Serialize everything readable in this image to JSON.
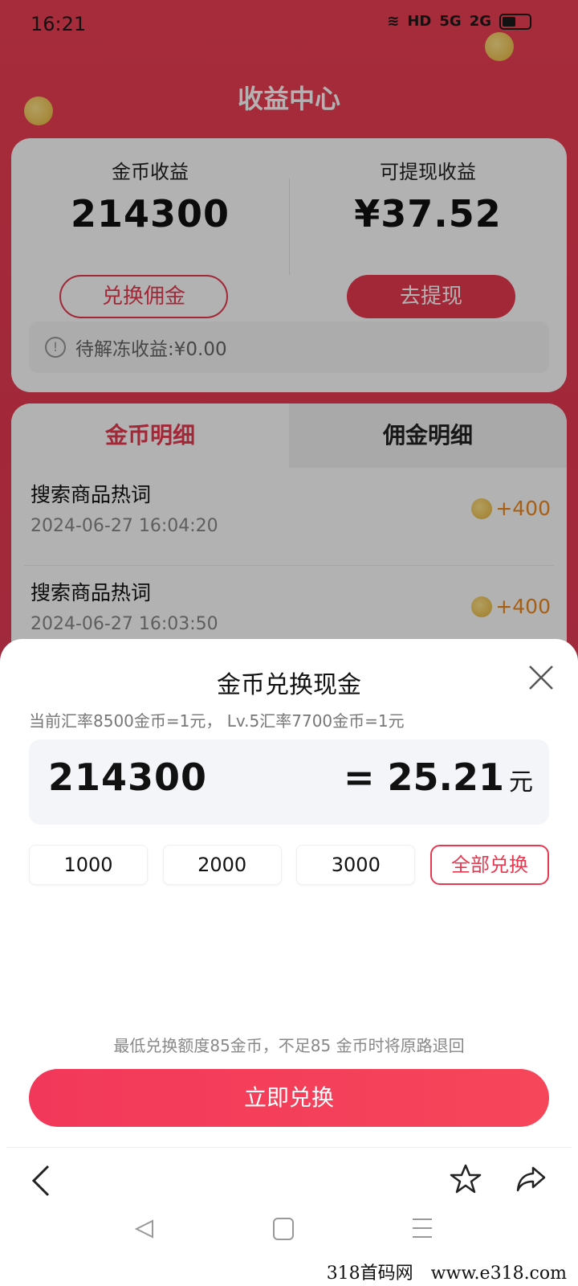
{
  "status_bar": {
    "time": "16:21",
    "signal_a": "5G",
    "signal_b": "2G",
    "hd": "HD"
  },
  "page": {
    "title": "收益中心"
  },
  "earnings": {
    "coin_label": "金币收益",
    "coin_value": "214300",
    "coin_button": "兑换佣金",
    "cash_label": "可提现收益",
    "cash_value": "¥37.52",
    "cash_button": "去提现",
    "frozen_text": "待解冻收益:¥0.00"
  },
  "detail": {
    "tabs": [
      {
        "label": "金币明细"
      },
      {
        "label": "佣金明细"
      }
    ],
    "records": [
      {
        "title": "搜索商品热词",
        "time": "2024-06-27 16:04:20",
        "amount": "+400"
      },
      {
        "title": "搜索商品热词",
        "time": "2024-06-27 16:03:50",
        "amount": "+400"
      }
    ]
  },
  "sheet": {
    "title": "金币兑换现金",
    "rate_text": "当前汇率8500金币=1元， Lv.5汇率7700金币=1元",
    "input_value": "214300",
    "result_value": "= 25.21",
    "result_unit": "元",
    "quick_options": [
      {
        "label": "1000"
      },
      {
        "label": "2000"
      },
      {
        "label": "3000"
      },
      {
        "label": "全部兑换"
      }
    ],
    "min_note": "最低兑换额度85金币，不足85 金币时将原路退回",
    "redeem_button": "立即兑换"
  },
  "watermark": "318首码网　www.e318.com",
  "colors": {
    "accent": "#e8384f",
    "coin": "#f08a1c",
    "header_bg": "#ee3f55"
  }
}
